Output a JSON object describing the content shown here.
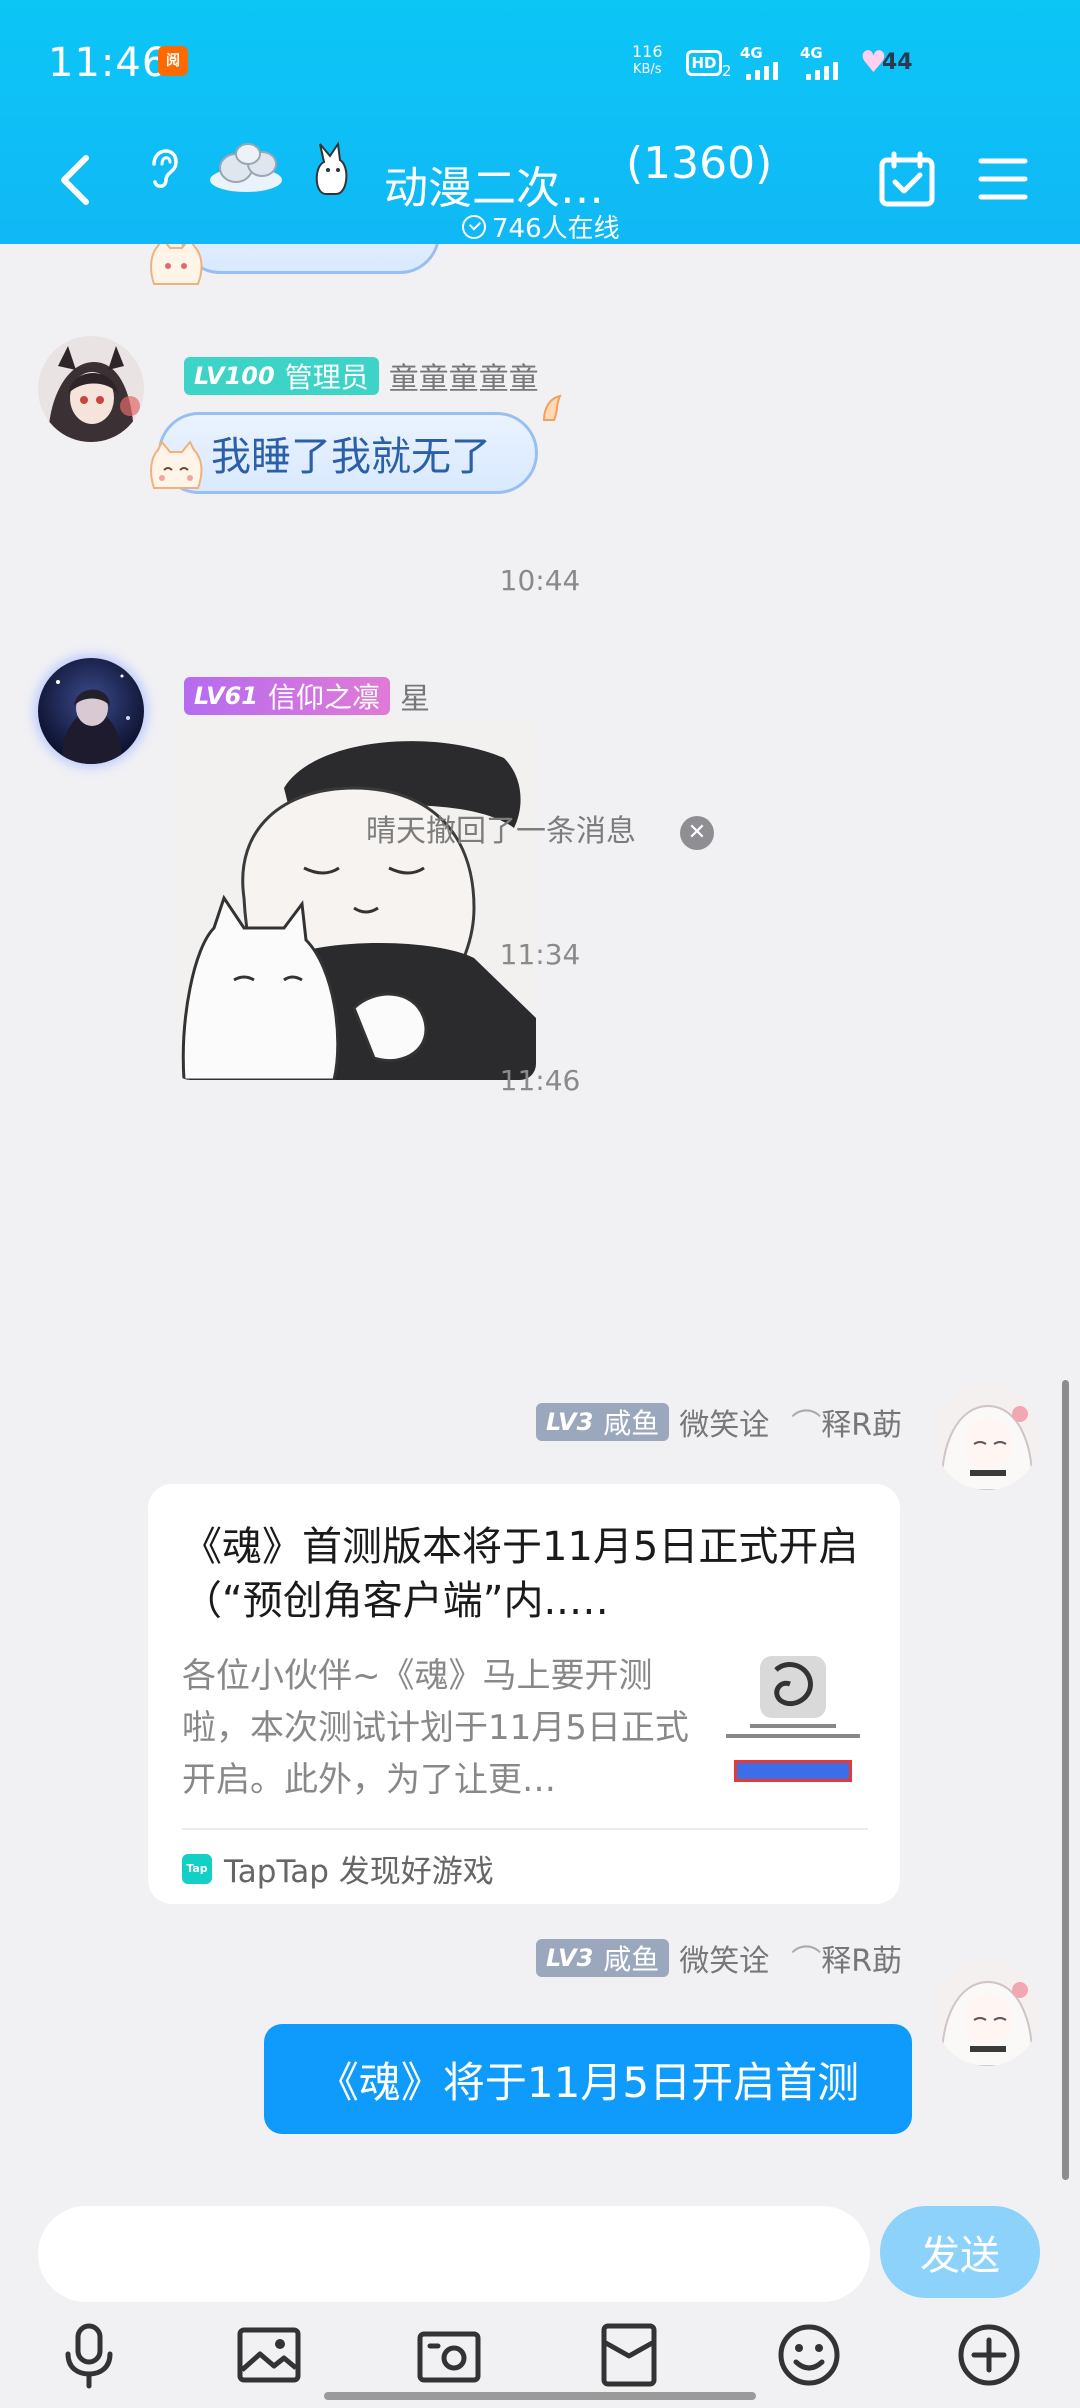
{
  "status_bar": {
    "time": "11:46",
    "app_badge": "阅",
    "net_speed_value": "116",
    "net_speed_unit": "KB/s",
    "hd": "HD",
    "hd_sub": "2",
    "signal1": "4G",
    "signal2": "4G",
    "battery": "44"
  },
  "header": {
    "title": "动漫二次…",
    "member_count": "(1360)",
    "online": "746人在线"
  },
  "messages": {
    "msg1": {
      "level": "LV100",
      "role": "管理员",
      "nickname": "童童童童童",
      "text": "我睡了我就无了"
    },
    "time1": "10:44",
    "msg2": {
      "level": "LV61",
      "role": "信仰之凛",
      "nickname": "星"
    },
    "time2": "11:34",
    "recall": "晴天撤回了一条消息",
    "time3": "11:46",
    "msg3": {
      "level": "LV3",
      "role": "咸鱼",
      "nickname": "微笑诠",
      "nickname_suffix": "释R莇",
      "card_title": "《魂》首测版本将于11月5日正式开启（“预创角客户端”内..…",
      "card_desc": "各位小伙伴~《魂》马上要开测啦，本次测试计划于11月5日正式开启。此外，为了让更…",
      "card_source": "TapTap 发现好游戏",
      "source_icon": "Tap"
    },
    "msg4": {
      "level": "LV3",
      "role": "咸鱼",
      "nickname": "微笑诠",
      "nickname_suffix": "释R莇",
      "text": "《魂》将于11月5日开启首测"
    }
  },
  "input": {
    "placeholder": "",
    "send_label": "发送"
  },
  "toolbar": {
    "icons": [
      "microphone-icon",
      "image-icon",
      "camera-icon",
      "red-packet-icon",
      "emoji-icon",
      "plus-icon"
    ]
  },
  "colors": {
    "header": "#0cc6f6",
    "admin_badge": "#3dd3c6",
    "lv61_badge": "#c46ee8",
    "lv3_badge": "#9aa7bd",
    "self_bubble": "#0f9bfb",
    "send_button": "#8cd2fa"
  }
}
